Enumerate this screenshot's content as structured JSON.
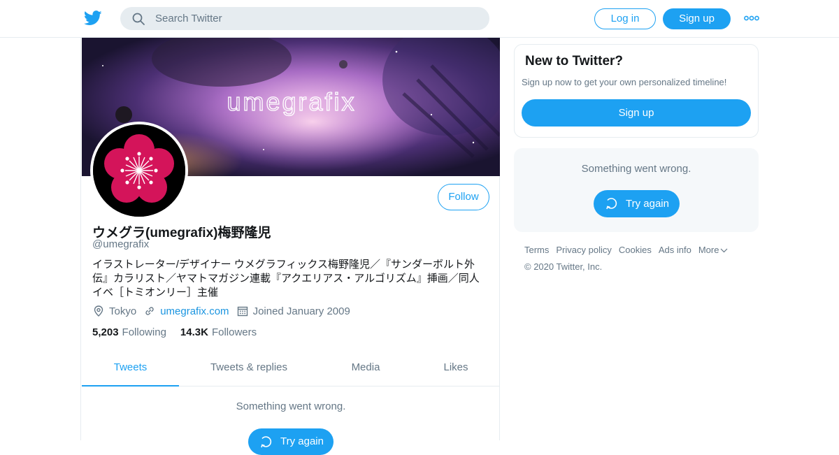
{
  "header": {
    "search_placeholder": "Search Twitter",
    "login_label": "Log in",
    "signup_label": "Sign up",
    "brand_color": "#1da1f2"
  },
  "profile": {
    "banner_text": "umegrafix",
    "name": "ウメグラ(umegrafix)梅野隆児",
    "handle": "@umegrafix",
    "bio": "イラストレーター/デザイナー ウメグラフィックス梅野隆児／『サンダーボルト外伝』カラリスト／ヤマトマガジン連載『アクエリアス・アルゴリズム』挿画／同人イベ［トミオンリー］主催",
    "follow_label": "Follow",
    "location": "Tokyo",
    "website": "umegrafix.com",
    "joined": "Joined January 2009",
    "following_count": "5,203",
    "following_label": "Following",
    "followers_count": "14.3K",
    "followers_label": "Followers",
    "tabs": [
      {
        "label": "Tweets",
        "active": true
      },
      {
        "label": "Tweets & replies",
        "active": false
      },
      {
        "label": "Media",
        "active": false
      },
      {
        "label": "Likes",
        "active": false
      }
    ],
    "timeline_error": "Something went wrong.",
    "try_again_label": "Try again"
  },
  "sidebar": {
    "signup_title": "New to Twitter?",
    "signup_text": "Sign up now to get your own personalized timeline!",
    "signup_button": "Sign up",
    "error_text": "Something went wrong.",
    "try_again_label": "Try again"
  },
  "footer": {
    "links": [
      "Terms",
      "Privacy policy",
      "Cookies",
      "Ads info",
      "More"
    ],
    "copyright": "© 2020 Twitter, Inc."
  }
}
